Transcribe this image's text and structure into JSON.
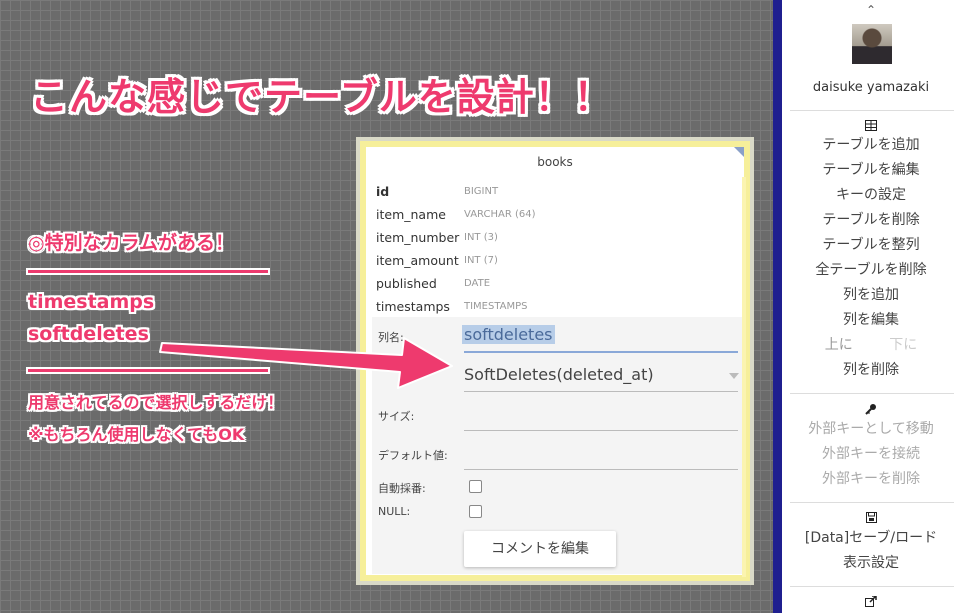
{
  "colors": {
    "accent": "#ee3a6e",
    "canvas": "#6b6b6b",
    "card": "#f6ef9a",
    "sidebar_bar": "#1f1f8f"
  },
  "annotation": {
    "headline": "こんな感じでテーブルを設計！！",
    "notes": {
      "title": "◎特別なカラムがある！",
      "item1": "timestamps",
      "item2": "softdeletes",
      "line1": "用意されてるので選択しするだけ！",
      "line2": "※もちろん使用しなくてもOK"
    }
  },
  "table": {
    "name": "books",
    "columns": [
      {
        "name": "id",
        "type": "BIGINT",
        "primary": true
      },
      {
        "name": "item_name",
        "type": "VARCHAR (64)"
      },
      {
        "name": "item_number",
        "type": "INT (3)"
      },
      {
        "name": "item_amount",
        "type": "INT (7)"
      },
      {
        "name": "published",
        "type": "DATE"
      },
      {
        "name": "timestamps",
        "type": "TIMESTAMPS"
      }
    ],
    "editor": {
      "column_name_label": "列名:",
      "column_name_value": "softdeletes",
      "type_value": "SoftDeletes(deleted_at)",
      "size_label": "サイズ:",
      "default_label": "デフォルト値:",
      "auto_increment_label": "自動採番:",
      "null_label": "NULL:",
      "auto_increment_checked": false,
      "null_checked": false,
      "comment_button": "コメントを編集"
    }
  },
  "sidebar": {
    "username": "daisuke yamazaki",
    "table_icon": "table-icon",
    "table_items": [
      "テーブルを追加",
      "テーブルを編集",
      "キーの設定",
      "テーブルを削除",
      "テーブルを整列",
      "全テーブルを削除",
      "列を追加",
      "列を編集"
    ],
    "move_up": "上に",
    "move_down": "下に",
    "delete_column": "列を削除",
    "key_icon": "key-icon",
    "fk_items": [
      "外部キーとして移動",
      "外部キーを接続",
      "外部キーを削除"
    ],
    "save_icon": "save-icon",
    "data_items": [
      "[Data]セーブ/ロード",
      "表示設定"
    ],
    "export_icon": "export-icon"
  }
}
